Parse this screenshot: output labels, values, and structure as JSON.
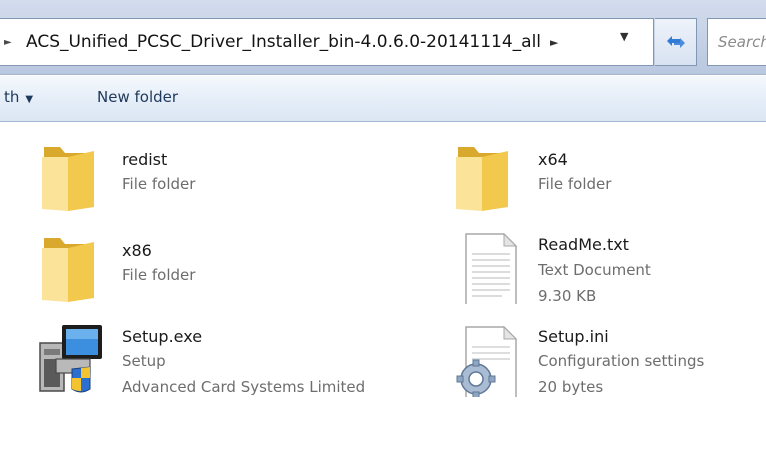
{
  "address_bar": {
    "path_segment": "ACS_Unified_PCSC_Driver_Installer_bin-4.0.6.0-20141114_all",
    "search_placeholder": "Search"
  },
  "command_bar": {
    "share_label": "th",
    "new_folder_label": "New folder"
  },
  "files": [
    {
      "name": "redist",
      "type": "File folder",
      "detail": "",
      "icon": "folder-icon"
    },
    {
      "name": "x64",
      "type": "File folder",
      "detail": "",
      "icon": "folder-icon"
    },
    {
      "name": "x86",
      "type": "File folder",
      "detail": "",
      "icon": "folder-icon"
    },
    {
      "name": "ReadMe.txt",
      "type": "Text Document",
      "detail": "9.30 KB",
      "icon": "text-document-icon"
    },
    {
      "name": "Setup.exe",
      "type": "Setup",
      "detail": "Advanced Card Systems Limited",
      "icon": "setup-installer-icon"
    },
    {
      "name": "Setup.ini",
      "type": "Configuration settings",
      "detail": "20 bytes",
      "icon": "config-settings-icon"
    }
  ],
  "colors": {
    "command_text": "#1e395b",
    "meta_text": "#6d6d6d",
    "folder_yellow": "#f2d26b"
  }
}
